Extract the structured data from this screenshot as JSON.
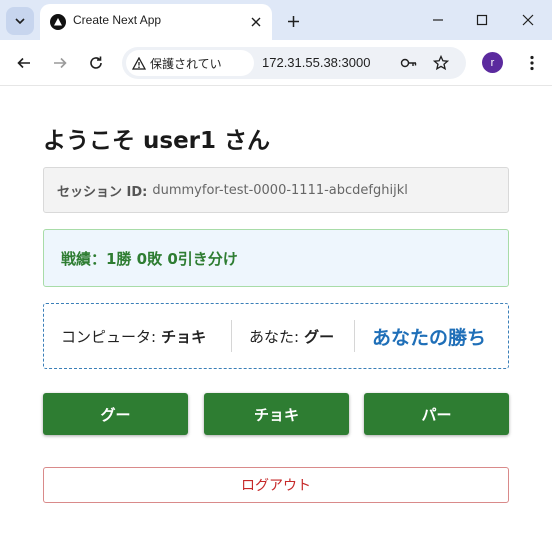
{
  "browser": {
    "tab_title": "Create Next App",
    "security_label": "保護されてい",
    "url": "172.31.55.38:3000",
    "avatar_initial": "r"
  },
  "page": {
    "heading": "ようこそ user1 さん",
    "session": {
      "label": "セッション ID:",
      "value": "dummyfor-test-0000-1111-abcdefghijkl"
    },
    "record_text": "戦績：1勝 0敗 0引き分け",
    "result": {
      "computer_label": "コンピュータ:",
      "computer_hand": "チョキ",
      "you_label": "あなた:",
      "you_hand": "グー",
      "outcome": "あなたの勝ち"
    },
    "hands": [
      "グー",
      "チョキ",
      "パー"
    ],
    "logout_label": "ログアウト"
  },
  "colors": {
    "hand_button": "#2e7d32",
    "record_text": "#2e7d32",
    "outcome_text": "#1f6fb8",
    "logout_text": "#c62828"
  }
}
